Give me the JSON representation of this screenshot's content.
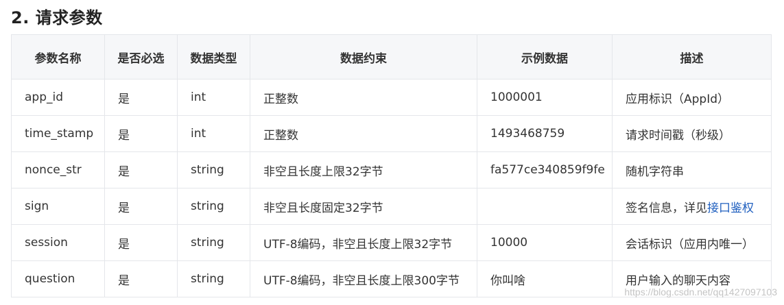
{
  "section": {
    "title": "2. 请求参数"
  },
  "table": {
    "headers": [
      "参数名称",
      "是否必选",
      "数据类型",
      "数据约束",
      "示例数据",
      "描述"
    ],
    "rows": [
      {
        "name": "app_id",
        "required": "是",
        "type": "int",
        "constraint": "正整数",
        "example": "1000001",
        "desc": "应用标识（AppId）"
      },
      {
        "name": "time_stamp",
        "required": "是",
        "type": "int",
        "constraint": "正整数",
        "example": "1493468759",
        "desc": "请求时间戳（秒级）"
      },
      {
        "name": "nonce_str",
        "required": "是",
        "type": "string",
        "constraint": "非空且长度上限32字节",
        "example": "fa577ce340859f9fe",
        "desc": "随机字符串"
      },
      {
        "name": "sign",
        "required": "是",
        "type": "string",
        "constraint": "非空且长度固定32字节",
        "example": "",
        "desc": "签名信息，详见",
        "desc_link": "接口鉴权"
      },
      {
        "name": "session",
        "required": "是",
        "type": "string",
        "constraint": "UTF-8编码，非空且长度上限32字节",
        "example": "10000",
        "desc": "会话标识（应用内唯一）"
      },
      {
        "name": "question",
        "required": "是",
        "type": "string",
        "constraint": "UTF-8编码，非空且长度上限300字节",
        "example": "你叫啥",
        "desc": "用户输入的聊天内容"
      }
    ]
  },
  "watermark": "https://blog.csdn.net/qq1427097103",
  "colors": {
    "header_bg": "#f6f7f9",
    "border": "#e4e6ea",
    "link": "#1f5fbf"
  }
}
